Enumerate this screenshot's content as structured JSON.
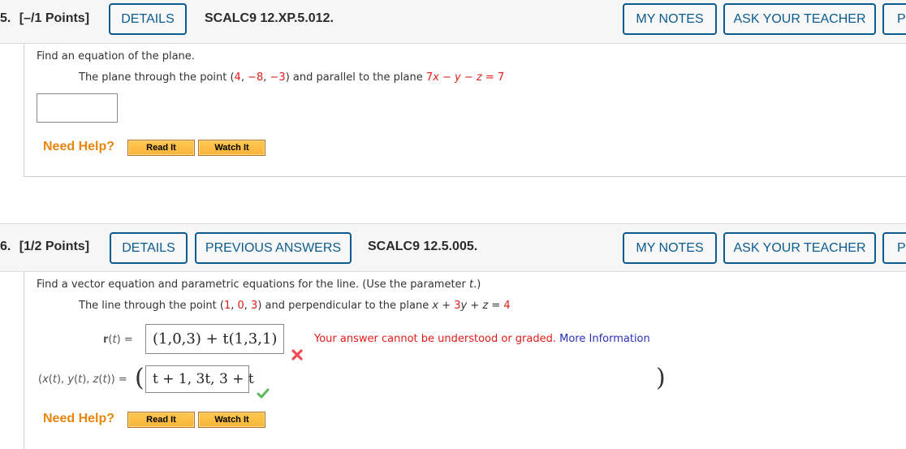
{
  "questions": [
    {
      "number_label": "5.",
      "points_label": "[–/1 Points]",
      "buttons": {
        "details": "DETAILS",
        "my_notes": "MY NOTES",
        "ask_teacher": "ASK YOUR TEACHER",
        "practice_partial": "P"
      },
      "code": "SCALC9 12.XP.5.012.",
      "prompt": "Find an equation of the plane.",
      "statement": {
        "prefix": "The plane through the point (",
        "point": [
          "4",
          "−8",
          "−3"
        ],
        "middle": ") and parallel to the plane ",
        "equation": "7x − y − z = 7"
      },
      "answer_value": "",
      "need_help": {
        "label": "Need Help?",
        "read_it": "Read It",
        "watch_it": "Watch It"
      }
    },
    {
      "number_label": "6.",
      "points_label": "[1/2 Points]",
      "buttons": {
        "details": "DETAILS",
        "previous_answers": "PREVIOUS ANSWERS",
        "my_notes": "MY NOTES",
        "ask_teacher": "ASK YOUR TEACHER",
        "practice_partial": "P"
      },
      "code": "SCALC9 12.5.005.",
      "prompt_prefix": "Find a vector equation and parametric equations for the line. (Use the parameter ",
      "prompt_param": "t",
      "prompt_suffix": ".)",
      "statement": {
        "prefix": "The line through the point (",
        "point": [
          "1",
          "0",
          "3"
        ],
        "middle": ") and perpendicular to the plane ",
        "eq_x": "x",
        "eq_plus1": " + ",
        "eq_3": "3",
        "eq_y": "y",
        "eq_plus2": " + ",
        "eq_z": "z",
        "eq_equals": " = ",
        "eq_rhs": "4"
      },
      "vector_eq": {
        "label": "r(t) =",
        "answer": "(1,0,3) + t(1,3,1)",
        "status": "incorrect",
        "feedback": "Your answer cannot be understood or graded.",
        "feedback_link": "More Information"
      },
      "parametric_eq": {
        "label": "(x(t), y(t), z(t)) =",
        "answer": "t + 1, 3t, 3 + t",
        "status": "correct"
      },
      "need_help": {
        "label": "Need Help?",
        "read_it": "Read It",
        "watch_it": "Watch It"
      }
    }
  ],
  "colors": {
    "accent_blue": "#0c5b8f",
    "need_help_orange": "#e8850c",
    "error_red": "#e41b17",
    "correct_green": "#5cb85c",
    "link_blue": "#2a2fb8"
  }
}
